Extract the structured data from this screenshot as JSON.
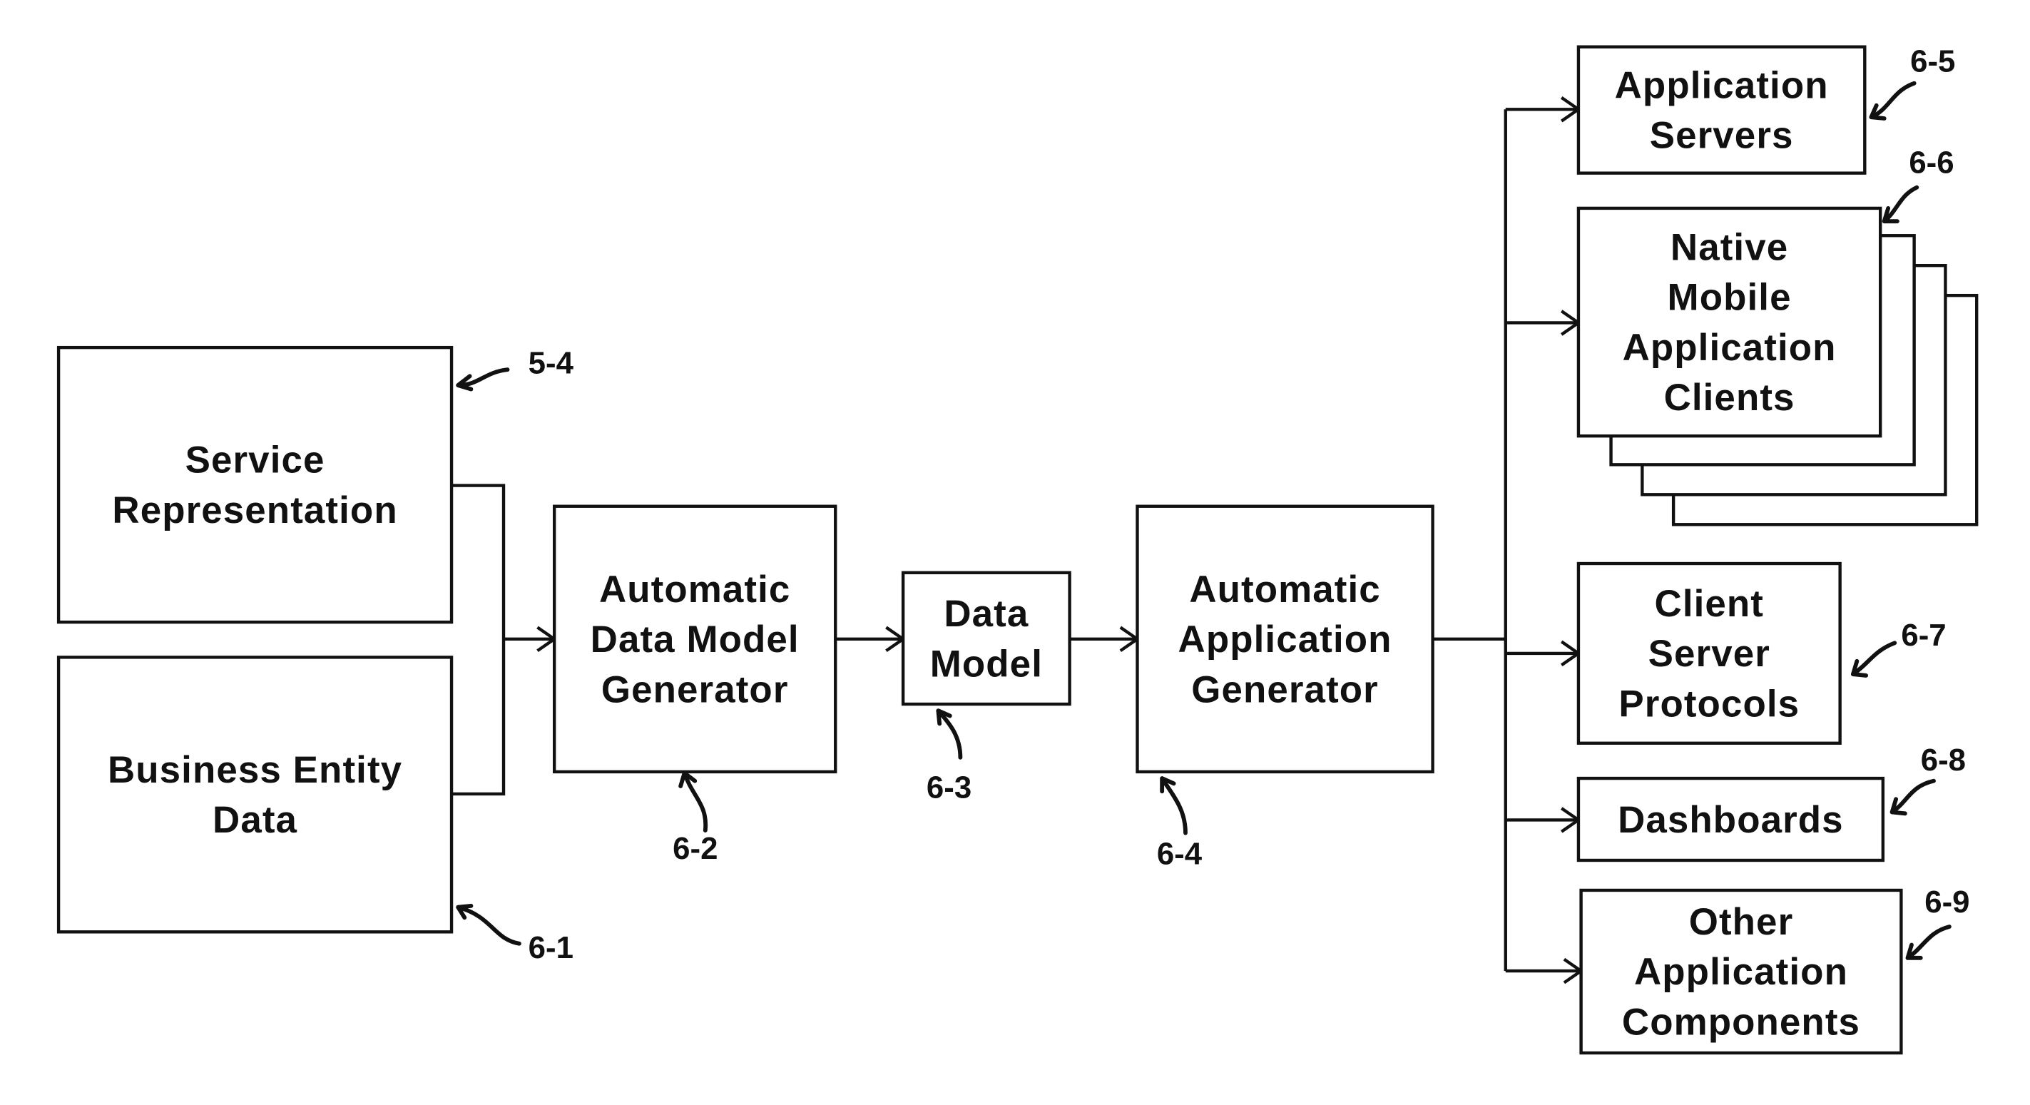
{
  "diagram": {
    "nodes": [
      {
        "id": "service-representation",
        "lines": [
          "Service",
          "Representation"
        ],
        "ref": "5-4"
      },
      {
        "id": "business-entity-data",
        "lines": [
          "Business Entity",
          "Data"
        ],
        "ref": "6-1"
      },
      {
        "id": "automatic-data-model-generator",
        "lines": [
          "Automatic",
          "Data Model",
          "Generator"
        ],
        "ref": "6-2"
      },
      {
        "id": "data-model",
        "lines": [
          "Data",
          "Model"
        ],
        "ref": "6-3"
      },
      {
        "id": "automatic-application-generator",
        "lines": [
          "Automatic",
          "Application",
          "Generator"
        ],
        "ref": "6-4"
      },
      {
        "id": "application-servers",
        "lines": [
          "Application",
          "Servers"
        ],
        "ref": "6-5"
      },
      {
        "id": "native-mobile-application-clients",
        "lines": [
          "Native",
          "Mobile",
          "Application",
          "Clients"
        ],
        "ref": "6-6"
      },
      {
        "id": "client-server-protocols",
        "lines": [
          "Client",
          "Server",
          "Protocols"
        ],
        "ref": "6-7"
      },
      {
        "id": "dashboards",
        "lines": [
          "Dashboards"
        ],
        "ref": "6-8"
      },
      {
        "id": "other-application-components",
        "lines": [
          "Other",
          "Application",
          "Components"
        ],
        "ref": "6-9"
      }
    ],
    "edges": [
      {
        "from": [
          "service-representation",
          "business-entity-data"
        ],
        "to": "automatic-data-model-generator"
      },
      {
        "from": [
          "automatic-data-model-generator"
        ],
        "to": "data-model"
      },
      {
        "from": [
          "data-model"
        ],
        "to": "automatic-application-generator"
      },
      {
        "from": [
          "automatic-application-generator"
        ],
        "to": "application-servers"
      },
      {
        "from": [
          "automatic-application-generator"
        ],
        "to": "native-mobile-application-clients"
      },
      {
        "from": [
          "automatic-application-generator"
        ],
        "to": "client-server-protocols"
      },
      {
        "from": [
          "automatic-application-generator"
        ],
        "to": "dashboards"
      },
      {
        "from": [
          "automatic-application-generator"
        ],
        "to": "other-application-components"
      }
    ]
  }
}
